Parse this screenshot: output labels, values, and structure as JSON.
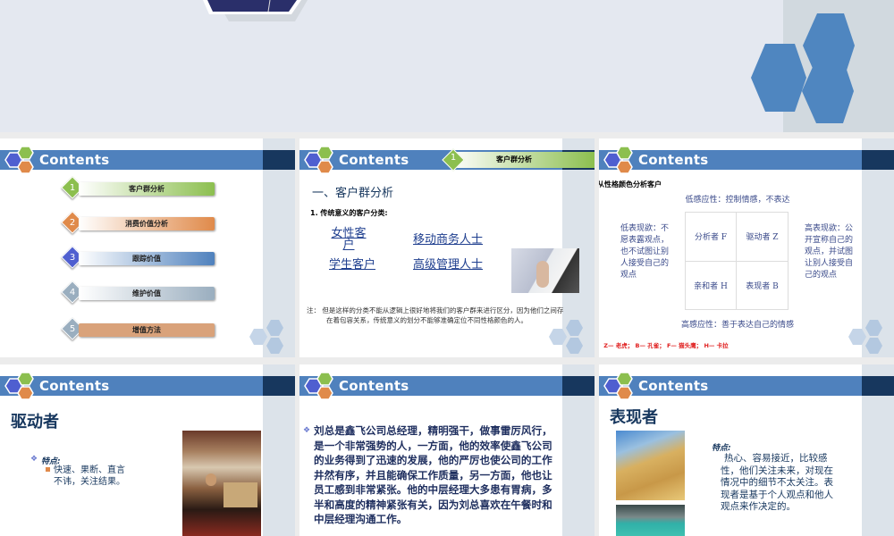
{
  "colors": {
    "accent": "#4f81bd",
    "navy": "#17375e",
    "green": "#8cbf4f",
    "orange": "#e08a4a",
    "blue": "#4f6fc0",
    "gray": "#9aaebf",
    "red": "#e02020"
  },
  "slides": [
    {
      "header": "Contents",
      "items": [
        {
          "num": "1",
          "label": "客户群分析"
        },
        {
          "num": "2",
          "label": "消费价值分析"
        },
        {
          "num": "3",
          "label": "跟踪价值"
        },
        {
          "num": "4",
          "label": "维护价值"
        },
        {
          "num": "5",
          "label": "增值方法"
        }
      ]
    },
    {
      "header": "Contents",
      "tab": {
        "num": "1",
        "label": "客户群分析"
      },
      "heading": "一、客户群分析",
      "subheading": "1. 传统意义的客户分类:",
      "links": [
        "女性客户",
        "移动商务人士",
        "学生客户",
        "高级管理人士"
      ],
      "note": "注： 但是这样的分类不能从逻辑上很好地将我们的客户群来进行区分，因为他们之间存在着包容关系，传统意义的划分不能够准确定位不同性格颜色的人。"
    },
    {
      "header": "Contents",
      "title": "从性格颜色分析客户",
      "top": "低感应性：控制情感，不表达",
      "bottom": "高感应性：善于表达自己的情感",
      "left": "低表现欲：不愿表露观点，也不试图让别人接受自己的观点",
      "right": "高表现欲：公开宣称自己的观点，并试图让别人接受自己的观点",
      "grid": [
        "分析者 F",
        "驱动者 Z",
        "亲和者 H",
        "表现者 B"
      ],
      "legend": "注： Z— 老虎； B— 孔雀； F— 猫头鹰； H— 卡拉"
    },
    {
      "header": "Contents",
      "title": "驱动者",
      "feature_label": "特点:",
      "feature": "快速、果断、直言不讳，关注结果。"
    },
    {
      "header": "Contents",
      "paragraph": "刘总是鑫飞公司总经理，精明强干，做事雷厉风行，是一个非常强势的人，一方面，他的效率使鑫飞公司的业务得到了迅速的发展，他的严厉也使公司的工作井然有序，并且能确保工作质量，另一方面，他也让员工感到非常紧张。他的中层经理大多患有胃病，多半和高度的精神紧张有关，因为刘总喜欢在午餐时和中层经理沟通工作。"
    },
    {
      "header": "Contents",
      "title": "表现者",
      "feature_label": "特点:",
      "feature": "热心、容易接近，比较感性，他们关注未来，对现在情况中的细节不太关注。表现者是基于个人观点和他人观点来作决定的。"
    }
  ]
}
